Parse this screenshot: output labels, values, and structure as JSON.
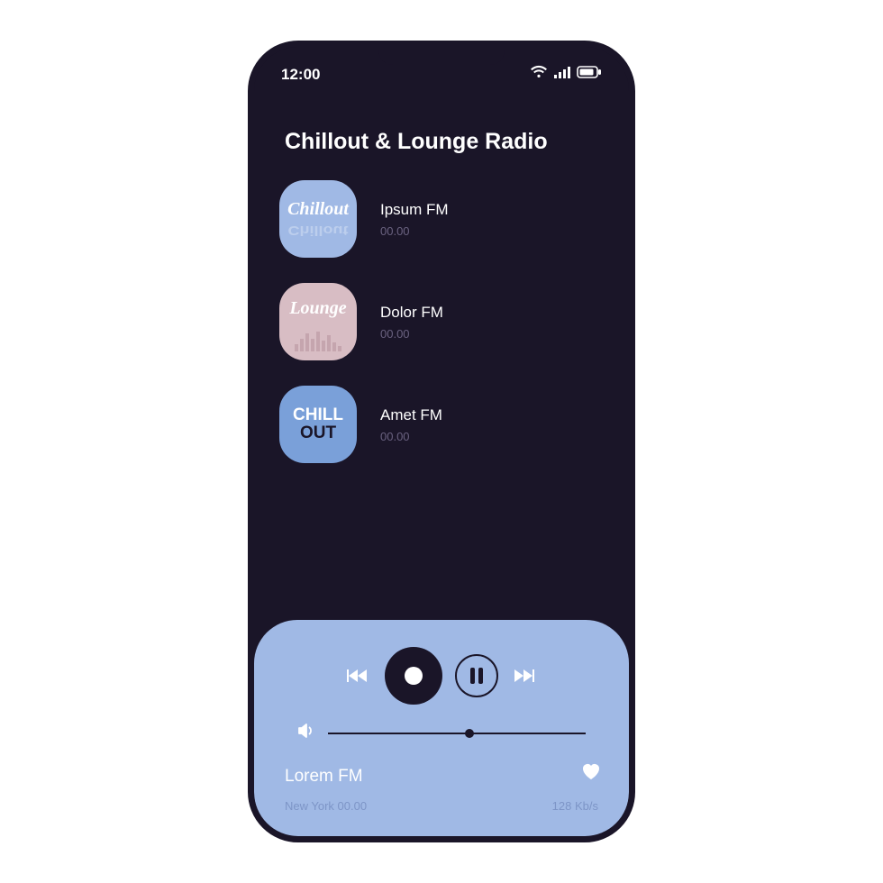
{
  "statusbar": {
    "time": "12:00"
  },
  "page": {
    "title": "Chillout & Lounge Radio"
  },
  "stations": [
    {
      "name": "Ipsum FM",
      "time": "00.00",
      "thumb_label": "Chillout",
      "thumb_style": "chillout"
    },
    {
      "name": "Dolor FM",
      "time": "00.00",
      "thumb_label": "Lounge",
      "thumb_style": "lounge"
    },
    {
      "name": "Amet FM",
      "time": "00.00",
      "thumb_label_line1": "CHILL",
      "thumb_label_line2": "OUT",
      "thumb_style": "chillout2"
    }
  ],
  "player": {
    "now_playing": "Lorem FM",
    "location": "New York 00.00",
    "bitrate": "128 Kb/s",
    "volume_percent": 55
  },
  "colors": {
    "bg_dark": "#1a1528",
    "panel_blue": "#a0b9e5",
    "panel_pink": "#d8bdc4",
    "muted": "#7d95c7"
  }
}
